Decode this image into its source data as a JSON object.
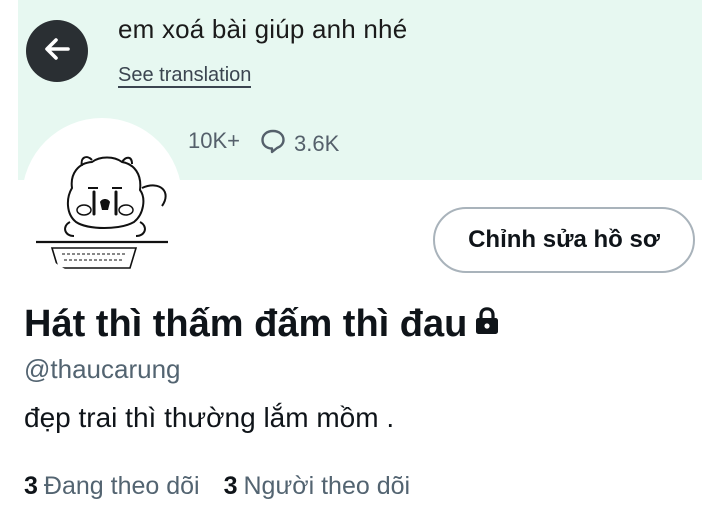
{
  "banner": {
    "tweet_text": "em xoá bài giúp anh nhé",
    "translation_link": "See translation",
    "likes_count": "10K+",
    "replies_count": "3.6K"
  },
  "profile": {
    "edit_button_label": "Chỉnh sửa hồ sơ",
    "display_name": "Hát thì thấm đấm thì đau",
    "handle": "@thaucarung",
    "bio": "đẹp trai thì thường lắm mồm .",
    "following_count": "3",
    "following_label": "Đang theo dõi",
    "followers_count": "3",
    "followers_label": "Người theo dõi"
  },
  "colors": {
    "banner_bg": "#e7f8f1",
    "back_button_bg": "#2a2f33",
    "secondary_text": "#536471",
    "primary_text": "#0f1419"
  },
  "icons": [
    "back-arrow-icon",
    "heart-icon",
    "reply-icon",
    "lock-icon"
  ]
}
